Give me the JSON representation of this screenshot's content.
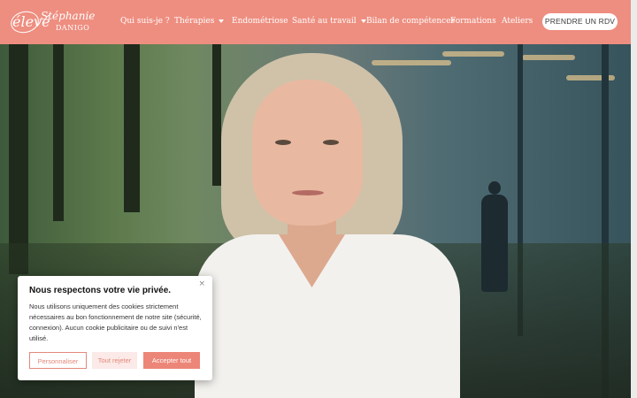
{
  "header": {
    "logo": {
      "mark": "élevé",
      "name": "Stéphanie",
      "surname": "DANIGO"
    },
    "nav": [
      {
        "label": "Qui suis-je ?",
        "dropdown": false
      },
      {
        "label": "Thérapies",
        "dropdown": true
      },
      {
        "label": "Endométriose",
        "dropdown": false
      },
      {
        "label": "Santé au travail",
        "dropdown": true
      },
      {
        "label": "Bilan de compétences",
        "dropdown": false
      },
      {
        "label": "Formations",
        "dropdown": false
      },
      {
        "label": "Ateliers",
        "dropdown": false
      }
    ],
    "cta": "PRENDRE UN RDV"
  },
  "cookie": {
    "close_icon": "×",
    "title": "Nous respectons votre vie privée.",
    "text": "Nous utilisons uniquement des cookies strictement nécessaires au bon fonctionnement de notre site (sécurité, connexion). Aucun cookie publicitaire ou de suivi n'est utilisé.",
    "buttons": {
      "customize": "Personnaliser",
      "reject": "Tout rejeter",
      "accept": "Accepter tout"
    }
  },
  "colors": {
    "brand": "#ee8e80",
    "accent_button": "#ec8678",
    "white": "#ffffff"
  },
  "icons": {
    "dropdown": "chevron-down-icon",
    "close": "close-icon"
  }
}
